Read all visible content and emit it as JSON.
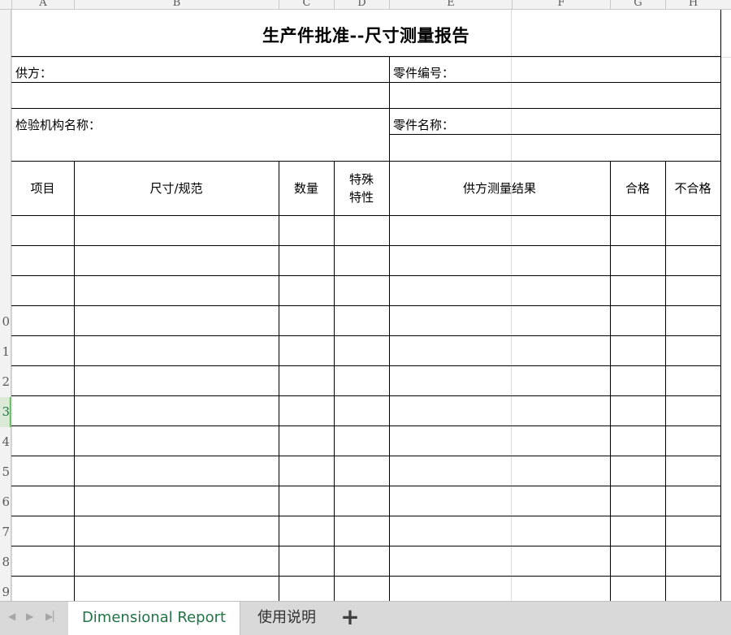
{
  "columns": [
    "A",
    "B",
    "C",
    "D",
    "E",
    "F",
    "G",
    "H"
  ],
  "rows": [
    "",
    "0",
    "1",
    "2",
    "3",
    "4",
    "5",
    "6",
    "7",
    "8",
    "9"
  ],
  "active_row": "3",
  "report": {
    "title": "生产件批准--尺寸测量报告",
    "supplier_label": "供方：",
    "part_number_label": "零件编号：",
    "inspection_org_label": "检验机构名称：",
    "part_name_label": "零件名称："
  },
  "table_headers": {
    "item": "项目",
    "dimension_spec": "尺寸/规范",
    "quantity": "数量",
    "special_char_line1": "特殊",
    "special_char_line2": "特性",
    "supplier_result": "供方测量结果",
    "pass": "合格",
    "fail": "不合格"
  },
  "sheet_tabs": {
    "prev_icon": "nav-prev",
    "next_icon": "nav-next",
    "last_icon": "nav-last",
    "active": "Dimensional Report",
    "second": "使用说明",
    "add": "+"
  },
  "colors": {
    "accent": "#217346",
    "tab_bar": "#d9d9d9",
    "header_bg": "#f2f2f2"
  }
}
